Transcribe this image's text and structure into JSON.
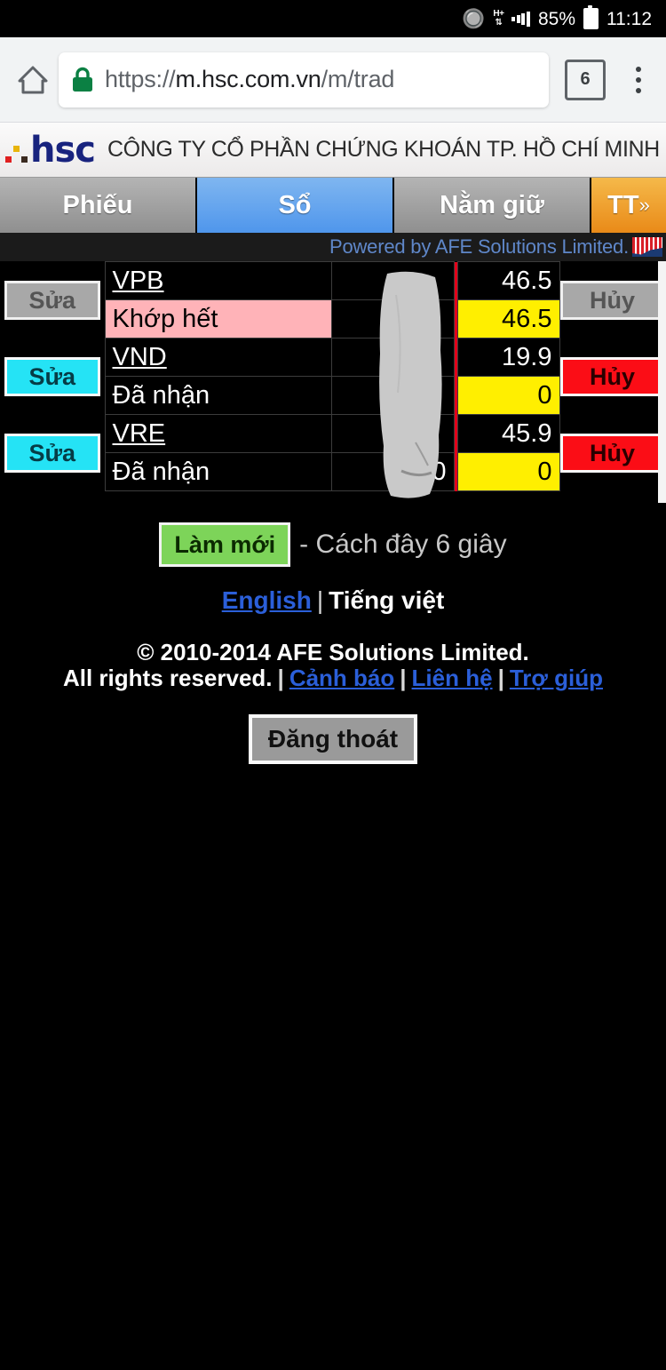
{
  "status_bar": {
    "bluetooth_icon": "bluetooth-icon",
    "network": "H+",
    "signal_icon": "signal-bars-icon",
    "battery_percent": "85%",
    "battery_icon": "battery-icon",
    "clock": "11:12"
  },
  "browser": {
    "home_icon": "home-icon",
    "lock_icon": "lock-icon",
    "url_secure": "https://",
    "url_host": "m.hsc.com.vn",
    "url_path": "/m/trad",
    "tab_count": "6",
    "menu_icon": "kebab-menu-icon"
  },
  "brand": {
    "logo_word": "hsc",
    "company": "CÔNG TY CỔ PHẦN CHỨNG KHOÁN TP.  HỒ CHÍ MINH"
  },
  "tabs": [
    {
      "label": "Phiếu",
      "active": false
    },
    {
      "label": "Sổ",
      "active": true
    },
    {
      "label": "Nằm giữ",
      "active": false
    },
    {
      "label": "TT",
      "chevron": "»",
      "active": false
    }
  ],
  "powered": {
    "text": "Powered by AFE Solutions Limited.",
    "logo_icon": "afe-logo-icon"
  },
  "orders": {
    "rows": [
      {
        "edit_label": "Sửa",
        "edit_state": "disabled",
        "symbol": "VPB",
        "status": "Khớp hết",
        "status_highlight": "pink",
        "qty": "",
        "filled_qty": "",
        "price": "46.5",
        "match_price": "46.5",
        "cancel_label": "Hủy",
        "cancel_state": "disabled"
      },
      {
        "edit_label": "Sửa",
        "edit_state": "enabled",
        "symbol": "VND",
        "status": "Đã nhận",
        "status_highlight": "none",
        "qty": "",
        "filled_qty": "",
        "price": "19.9",
        "match_price": "0",
        "cancel_label": "Hủy",
        "cancel_state": "enabled"
      },
      {
        "edit_label": "Sửa",
        "edit_state": "enabled",
        "symbol": "VRE",
        "status": "Đã nhận",
        "status_highlight": "none",
        "qty": "",
        "filled_qty": "0",
        "price": "45.9",
        "match_price": "0",
        "cancel_label": "Hủy",
        "cancel_state": "enabled"
      }
    ],
    "redaction_overlay": "gray-scribble-redaction",
    "scrollbar": "vertical-scrollbar"
  },
  "footer": {
    "refresh_label": "Làm mới",
    "refresh_ago": "- Cách đây 6 giây",
    "lang_english": "English",
    "lang_separator": "|",
    "lang_current": "Tiếng việt",
    "copyright_line1": "© 2010-2014 AFE Solutions Limited.",
    "rights_text": "All rights reserved.",
    "link_warning": "Cảnh báo",
    "link_contact": "Liên hệ",
    "link_help": "Trợ giúp",
    "logout_label": "Đăng thoát"
  },
  "colors": {
    "accent_blue": "#4f96ec",
    "tab_orange": "#e98a18",
    "highlight_yellow": "#ffef00",
    "status_pink": "#ffb3b8",
    "cancel_red": "#fb0d16",
    "edit_cyan": "#25e3f5",
    "refresh_green": "#7dd459",
    "link_blue": "#2b5fd9",
    "powered_blue": "#5f87c9"
  }
}
